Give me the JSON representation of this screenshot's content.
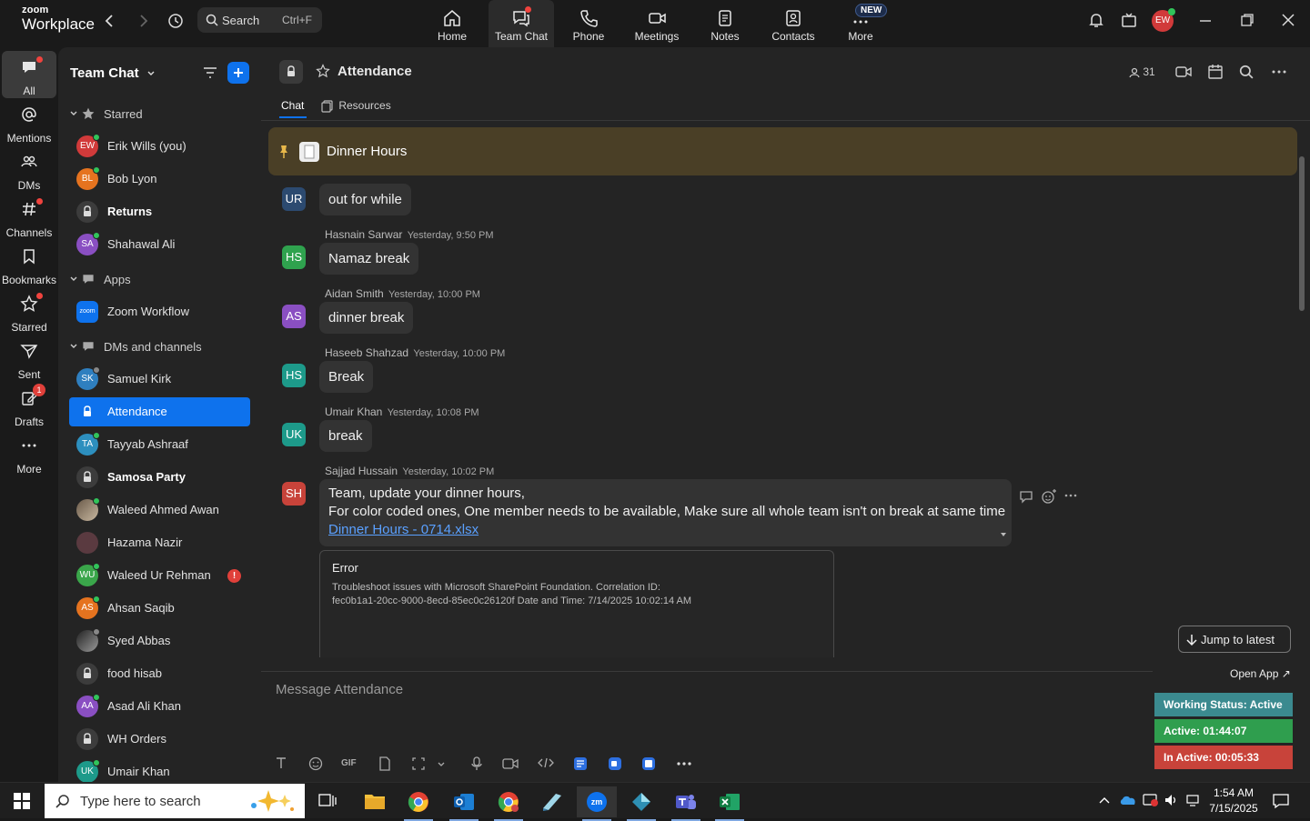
{
  "brand": {
    "line1": "zoom",
    "line2": "Workplace"
  },
  "search": {
    "label": "Search",
    "shortcut": "Ctrl+F"
  },
  "top_nav": [
    {
      "label": "Home"
    },
    {
      "label": "Team Chat"
    },
    {
      "label": "Phone"
    },
    {
      "label": "Meetings"
    },
    {
      "label": "Notes"
    },
    {
      "label": "Contacts"
    },
    {
      "label": "More"
    }
  ],
  "new_badge": "NEW",
  "user_initials": "EW",
  "rail": [
    {
      "label": "All"
    },
    {
      "label": "Mentions"
    },
    {
      "label": "DMs"
    },
    {
      "label": "Channels"
    },
    {
      "label": "Bookmarks"
    },
    {
      "label": "Starred"
    },
    {
      "label": "Sent"
    },
    {
      "label": "Drafts",
      "badge": "1"
    },
    {
      "label": "More"
    }
  ],
  "sidebar": {
    "title": "Team Chat",
    "sections": {
      "starred": "Starred",
      "apps": "Apps",
      "dms": "DMs and channels"
    },
    "starred": [
      {
        "initials": "EW",
        "name": "Erik Wills (you)"
      },
      {
        "initials": "BL",
        "name": "Bob Lyon"
      },
      {
        "initials": "",
        "name": "Returns"
      },
      {
        "initials": "SA",
        "name": "Shahawal Ali"
      }
    ],
    "apps": [
      {
        "initials": "zoom",
        "name": "Zoom Workflow"
      }
    ],
    "dms": [
      {
        "initials": "SK",
        "name": "Samuel Kirk"
      },
      {
        "initials": "",
        "name": "Attendance"
      },
      {
        "initials": "TA",
        "name": "Tayyab Ashraaf"
      },
      {
        "initials": "",
        "name": "Samosa Party"
      },
      {
        "initials": "",
        "name": "Waleed Ahmed Awan"
      },
      {
        "initials": "",
        "name": "Hazama Nazir"
      },
      {
        "initials": "WU",
        "name": "Waleed Ur Rehman",
        "badge": "!"
      },
      {
        "initials": "AS",
        "name": "Ahsan Saqib"
      },
      {
        "initials": "",
        "name": "Syed Abbas"
      },
      {
        "initials": "",
        "name": "food hisab"
      },
      {
        "initials": "AA",
        "name": "Asad Ali Khan"
      },
      {
        "initials": "",
        "name": "WH Orders"
      },
      {
        "initials": "UK",
        "name": "Umair Khan"
      }
    ]
  },
  "channel": {
    "title": "Attendance",
    "member_count": "31",
    "tabs": [
      "Chat",
      "Resources"
    ],
    "pinned": "Dinner Hours"
  },
  "messages": [
    {
      "initials": "UR",
      "text": "out for while"
    },
    {
      "initials": "HS",
      "sender": "Hasnain Sarwar",
      "time": "Yesterday, 9:50 PM",
      "text": "Namaz break"
    },
    {
      "initials": "AS",
      "sender": "Aidan Smith",
      "time": "Yesterday, 10:00 PM",
      "text": "dinner break"
    },
    {
      "initials": "HS",
      "sender": "Haseeb Shahzad",
      "time": "Yesterday, 10:00 PM",
      "text": "Break"
    },
    {
      "initials": "UK",
      "sender": "Umair Khan",
      "time": "Yesterday, 10:08 PM",
      "text": "break"
    },
    {
      "initials": "SH",
      "sender": "Sajjad Hussain",
      "time": "Yesterday, 10:02 PM",
      "line1": "Team, update your dinner hours,",
      "line2": "For color coded ones, One member needs to be available, Make sure all whole team isn't on break at same time",
      "link": "Dinner Hours - 0714.xlsx"
    }
  ],
  "error_card": {
    "title": "Error",
    "line1": "Troubleshoot issues with Microsoft SharePoint Foundation. Correlation ID:",
    "line2": "fec0b1a1-20cc-9000-8ecd-85ec0c26120f Date and Time: 7/14/2025 10:02:14 AM"
  },
  "jump_label": "Jump to latest",
  "compose_placeholder": "Message Attendance",
  "gif_label": "GIF",
  "widget": {
    "open_app": "Open App ↗",
    "working": "Working Status: Active",
    "active": "Active: 01:44:07",
    "inactive": "In Active: 00:05:33"
  },
  "taskbar": {
    "search_placeholder": "Type here to search",
    "time": "1:54 AM",
    "date": "7/15/2025"
  },
  "colors": {
    "accent": "#0e72ed",
    "pinned_bg": "#4a3f26",
    "working": "#3b8a8f",
    "active": "#2f9e4e",
    "inactive": "#c8433a"
  }
}
